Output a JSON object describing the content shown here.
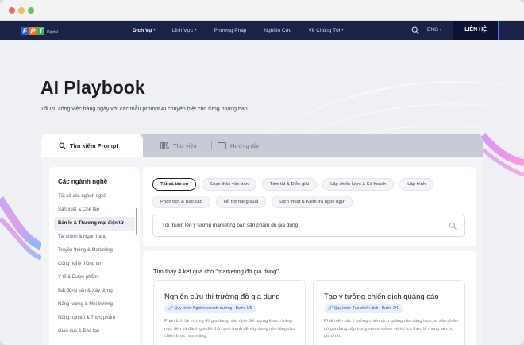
{
  "nav": {
    "logo_brand": "FPT",
    "logo_sub": "Digital",
    "menu": [
      {
        "label": "Dịch Vụ",
        "active": true,
        "dropdown": true
      },
      {
        "label": "Lĩnh Vực",
        "active": false,
        "dropdown": true
      },
      {
        "label": "Phương Pháp",
        "active": false,
        "dropdown": false
      },
      {
        "label": "Nghiên Cứu",
        "active": false,
        "dropdown": false
      },
      {
        "label": "Về Chúng Tôi",
        "active": false,
        "dropdown": true
      }
    ],
    "lang": "ENG",
    "contact_label": "LIÊN HỆ"
  },
  "hero": {
    "title": "AI Playbook",
    "subtitle": "Tối ưu công việc hàng ngày với các mẫu prompt AI chuyên biệt cho từng phòng ban"
  },
  "tabs": [
    {
      "label": "Tìm kiếm Prompt",
      "icon": "search-icon",
      "active": true
    },
    {
      "label": "Thư viện",
      "icon": "library-icon",
      "active": false
    },
    {
      "label": "Hướng dẫn",
      "icon": "guide-icon",
      "active": false
    }
  ],
  "sidebar": {
    "title": "Các ngành nghề",
    "items": [
      {
        "label": "Tất cả các ngành nghề",
        "active": false
      },
      {
        "label": "Sản xuất & Chế tạo",
        "active": false
      },
      {
        "label": "Bán lẻ & Thương mại điện tử",
        "active": true
      },
      {
        "label": "Tài chính & Ngân hàng",
        "active": false
      },
      {
        "label": "Truyền thông & Marketing",
        "active": false
      },
      {
        "label": "Công nghệ thông tin",
        "active": false
      },
      {
        "label": "Y tế & Dược phẩm",
        "active": false
      },
      {
        "label": "Bất động sản & Xây dựng",
        "active": false
      },
      {
        "label": "Năng lượng & Môi trường",
        "active": false
      },
      {
        "label": "Nông nghiệp & Thực phẩm",
        "active": false
      },
      {
        "label": "Giáo dục & Đào tạo",
        "active": false
      }
    ]
  },
  "filters": {
    "chips": [
      {
        "label": "Tất cả tác vụ",
        "active": true
      },
      {
        "label": "Soạn thảo văn bản",
        "active": false
      },
      {
        "label": "Tóm tắt & Diễn giải",
        "active": false
      },
      {
        "label": "Lập chiến lược & Kế hoạch",
        "active": false
      },
      {
        "label": "Lập trình",
        "active": false
      },
      {
        "label": "Phân tích & Báo cáo",
        "active": false
      },
      {
        "label": "Hỗ trợ năng suất",
        "active": false
      },
      {
        "label": "Dịch thuật & Kiểm tra ngôn ngữ",
        "active": false
      }
    ],
    "search_value": "Tôi muốn lên ý tưởng marketing bán sản phẩm đồ gia dụng"
  },
  "results": {
    "summary": "Tìm thấy 4 kết quả cho \"marketing đồ gia dụng\"",
    "cards": [
      {
        "title": "Nghiên cứu thị trường đồ gia dụng",
        "tag": "Quy trình: Nghiên cứu thị trường - Bước 1/5",
        "description": "Phân tích thị trường đồ gia dụng, xác định đối tượng khách hàng mục tiêu và đánh giá đối thủ cạnh tranh để xây dựng nền tảng cho chiến lược marketing"
      },
      {
        "title": "Tạo ý tưởng chiến dịch quảng cáo",
        "tag": "Quy trình: Tạo chiến dịch - Bước 2/4",
        "description": "Phát triển các ý tưởng chiến dịch quảng cáo sáng tạo cho sản phẩm đồ gia dụng, tập trung vào emotion và lợi ích thực tế mang lại cho gia đình."
      }
    ]
  },
  "colors": {
    "nav_bg": "#1c2247",
    "contact_bg": "#0d1233",
    "accent_blue": "#3f7bff",
    "tag_bg": "#e8efff",
    "tag_text": "#2d56b8"
  }
}
